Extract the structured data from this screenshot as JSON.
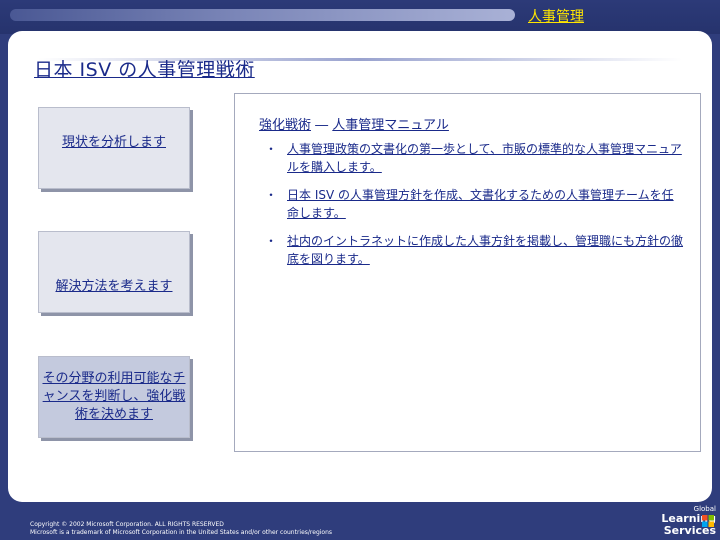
{
  "header": {
    "section_title": "人事管理"
  },
  "slide": {
    "title": "日本 ISV の人事管理戦術"
  },
  "steps": [
    {
      "label": "現状を分析します"
    },
    {
      "label": "解決方法を考えます"
    },
    {
      "label": "その分野の利用可能なチャンスを判断し、強化戦術を決めます"
    }
  ],
  "content": {
    "heading_left": "強化戦術",
    "heading_sep": "―",
    "heading_right": "人事管理マニュアル",
    "bullet_symbol": "・",
    "bullets": [
      "人事管理政策の文書化の第一歩として、市販の標準的な人事管理マニュアルを購入します。",
      "日本 ISV の人事管理方針を作成、文書化するための人事管理チームを任命します。",
      "社内のイントラネットに作成した人事方針を掲載し、管理職にも方針の徹底を図ります。"
    ]
  },
  "footer": {
    "copyright_line1": "Copyright © 2002 Microsoft Corporation. ALL RIGHTS RESERVED",
    "copyright_line2": "Microsoft is a trademark of Microsoft Corporation in the United States and/or other countries/regions",
    "logo_global": "Global",
    "logo_learning": "Learning",
    "logo_services": "Services"
  },
  "colors": {
    "background": "#2f3d7c",
    "text_navy": "#1a2a8a",
    "header_highlight": "#ffe600",
    "step_box": "#e4e6ee",
    "step_box_active": "#c4cade"
  }
}
